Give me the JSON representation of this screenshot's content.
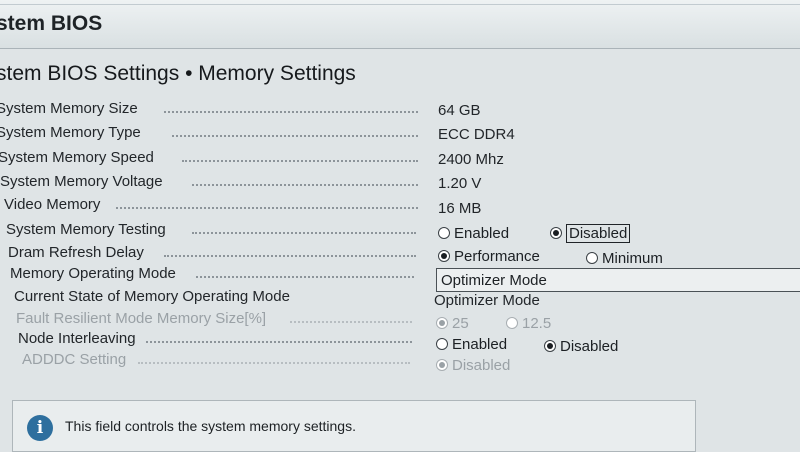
{
  "header": {
    "title": "stem BIOS"
  },
  "page": {
    "title": "stem BIOS Settings • Memory Settings"
  },
  "settings": [
    {
      "label": "System Memory Size",
      "value": "64 GB"
    },
    {
      "label": "System Memory Type",
      "value": "ECC DDR4"
    },
    {
      "label": "System Memory Speed",
      "value": "2400 Mhz"
    },
    {
      "label": "System Memory Voltage",
      "value": "1.20 V"
    },
    {
      "label": "Video Memory",
      "value": "16 MB"
    },
    {
      "label": "System Memory Testing",
      "options": [
        "Enabled",
        "Disabled"
      ],
      "selected": "Disabled"
    },
    {
      "label": "Dram Refresh Delay",
      "options": [
        "Performance",
        "Minimum"
      ],
      "selected": "Performance"
    },
    {
      "label": "Memory Operating Mode",
      "value": "Optimizer Mode"
    },
    {
      "label": "Current State of Memory Operating Mode",
      "value": "Optimizer Mode"
    },
    {
      "label": "Fault Resilient Mode Memory Size[%]",
      "options": [
        "25",
        "12.5"
      ],
      "selected": "25",
      "disabled": true
    },
    {
      "label": "Node Interleaving",
      "options": [
        "Enabled",
        "Disabled"
      ],
      "selected": "Disabled"
    },
    {
      "label": "ADDDC Setting",
      "options": [
        "Disabled"
      ],
      "selected": "Disabled",
      "disabled": true
    }
  ],
  "info": {
    "text": "This field controls the system memory settings.",
    "icon": "info-icon"
  },
  "colors": {
    "background": "#dfe4e6",
    "info_icon": "#2e6f9e"
  }
}
